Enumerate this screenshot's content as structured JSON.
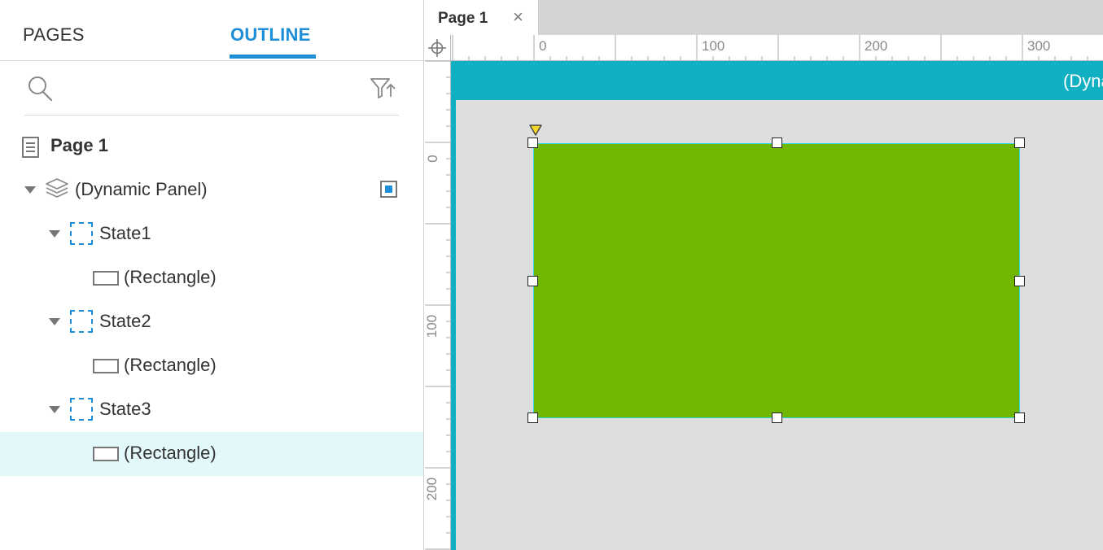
{
  "left_panel": {
    "tabs": {
      "pages": "PAGES",
      "outline": "OUTLINE"
    },
    "search": {
      "placeholder": ""
    },
    "tree": {
      "page": "Page 1",
      "dynamic_panel": "(Dynamic Panel)",
      "state1": "State1",
      "state2": "State2",
      "state3": "State3",
      "rect1": "(Rectangle)",
      "rect2": "(Rectangle)",
      "rect3": "(Rectangle)"
    }
  },
  "editor": {
    "tab_label": "Page 1",
    "tab_close": "×",
    "panel_label": "(Dynamic Panel)"
  },
  "rulers": {
    "horizontal_labels": [
      "0",
      "100",
      "200",
      "300"
    ],
    "vertical_labels": [
      "0",
      "100",
      "200"
    ]
  },
  "colors": {
    "accent": "#1e8ed8",
    "panel_header": "#11afc2",
    "rectangle_fill": "#6fb703",
    "selected_row": "#e3f8fb",
    "canvas_background": "#dedede"
  },
  "icons": {
    "search": "search-icon",
    "filter": "filter-sort-icon",
    "page": "page-icon",
    "dynamic_panel": "layers-icon",
    "state": "state-icon",
    "rectangle": "rectangle-icon",
    "crosshair": "crosshair-icon"
  }
}
